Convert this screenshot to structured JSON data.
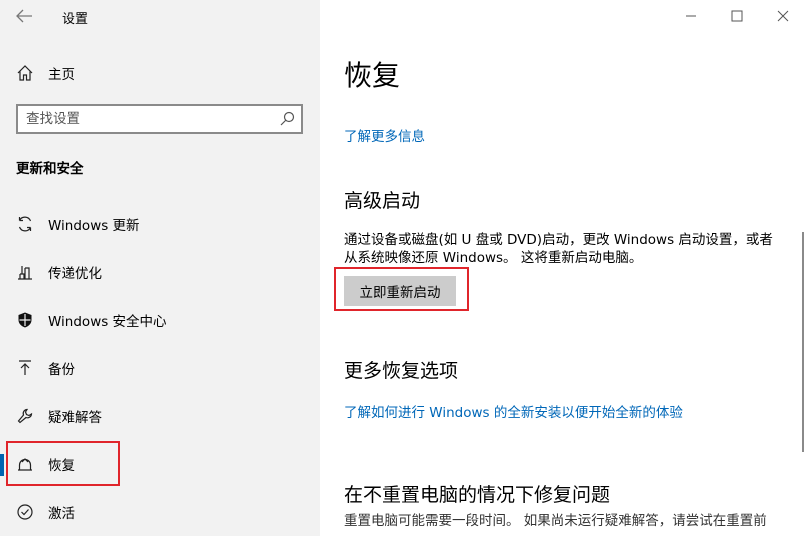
{
  "app": {
    "title": "设置"
  },
  "sidebar": {
    "home_label": "主页",
    "search_placeholder": "查找设置",
    "section_header": "更新和安全",
    "items": [
      {
        "label": "Windows 更新",
        "icon": "sync-icon"
      },
      {
        "label": "传递优化",
        "icon": "delivery-optimization-icon"
      },
      {
        "label": "Windows 安全中心",
        "icon": "shield-icon"
      },
      {
        "label": "备份",
        "icon": "backup-arrow-icon"
      },
      {
        "label": "疑难解答",
        "icon": "wrench-icon"
      },
      {
        "label": "恢复",
        "icon": "recovery-icon",
        "active": true
      },
      {
        "label": "激活",
        "icon": "activation-check-icon"
      }
    ]
  },
  "window_controls": {
    "minimize": "minimize-icon",
    "maximize": "maximize-icon",
    "close": "close-icon"
  },
  "main": {
    "title": "恢复",
    "learn_more": "了解更多信息",
    "advanced_startup": {
      "heading": "高级启动",
      "description_line1": "通过设备或磁盘(如 U 盘或 DVD)启动，更改 Windows 启动设置，或者",
      "description_line2": "从系统映像还原 Windows。 这将重新启动电脑。",
      "button": "立即重新启动"
    },
    "more_recovery": {
      "heading": "更多恢复选项",
      "link": "了解如何进行 Windows 的全新安装以便开始全新的体验"
    },
    "fix_without_reset": {
      "heading": "在不重置电脑的情况下修复问题",
      "description": "重置电脑可能需要一段时间。 如果尚未运行疑难解答，请尝试在重置前"
    }
  },
  "colors": {
    "accent": "#0067b8",
    "highlight": "#e0252b",
    "sidebar_bg": "#f2f2f2"
  }
}
